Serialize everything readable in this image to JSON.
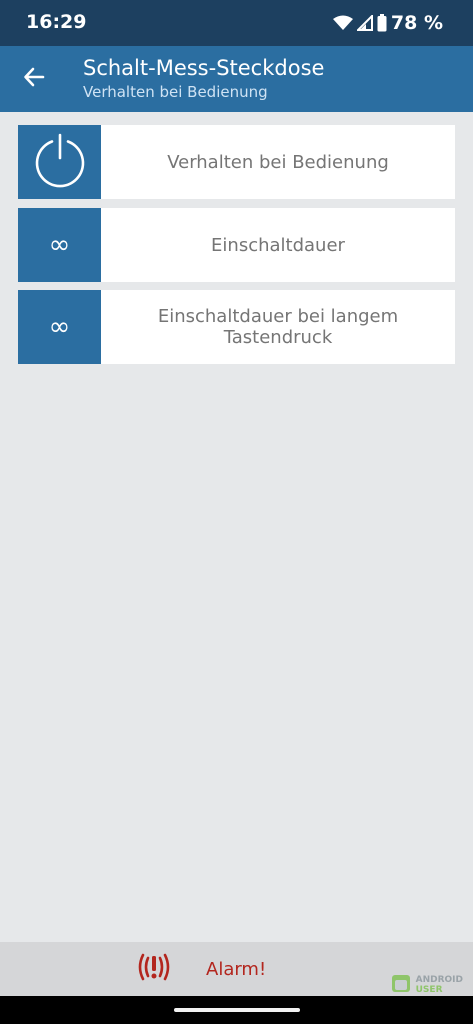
{
  "status": {
    "time": "16:29",
    "battery": "78 %"
  },
  "appbar": {
    "title": "Schalt-Mess-Steckdose",
    "subtitle": "Verhalten bei Bedienung"
  },
  "menu": [
    {
      "label": "Verhalten bei Bedienung",
      "icon": "power-icon"
    },
    {
      "label": "Einschaltdauer",
      "icon_text": "∞",
      "icon": "infinity-icon"
    },
    {
      "label": "Einschaltdauer bei langem Tastendruck",
      "icon_text": "∞",
      "icon": "infinity-icon"
    }
  ],
  "alarm": {
    "label": "Alarm!",
    "color": "#b3261e"
  },
  "watermark": {
    "line1": "ANDROID",
    "line2": "USER"
  },
  "colors": {
    "header_dark": "#1d4060",
    "header": "#2b6ea1",
    "background": "#e6e8ea"
  }
}
